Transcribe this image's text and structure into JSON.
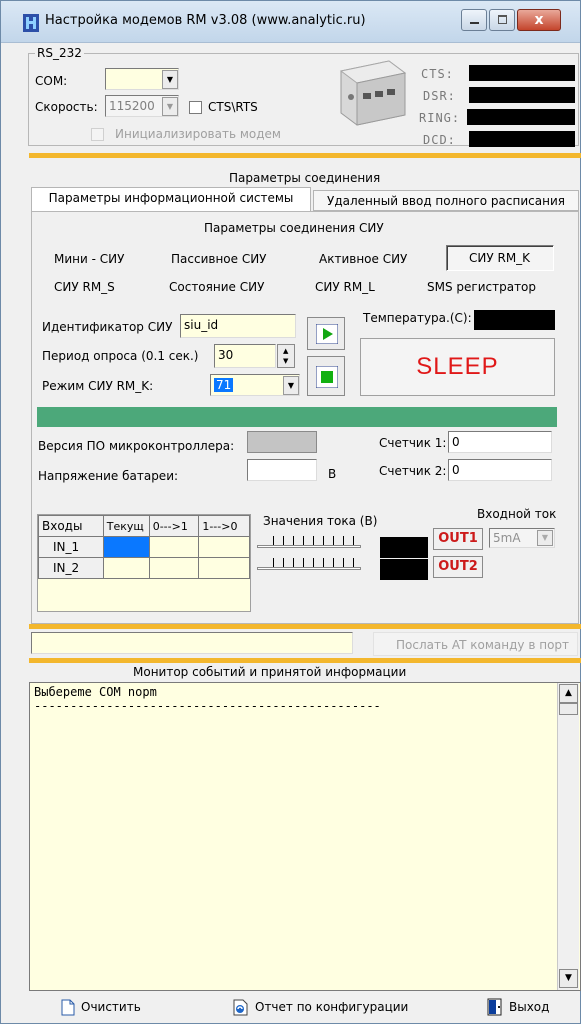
{
  "window": {
    "title": "Настройка модемов RM v3.08 (www.analytic.ru)",
    "minimize_icon": "minimize-icon",
    "maximize_icon": "maximize-icon",
    "close_icon": "close-icon",
    "close_label": "x"
  },
  "rs232": {
    "group_label": "RS_232",
    "com_label": "COM:",
    "com_value": "",
    "speed_label": "Скорость:",
    "speed_value": "115200",
    "cts_rts_label": "CTS\\RTS",
    "init_modem_label": "Инициализировать модем",
    "signals": [
      "CTS:",
      "DSR:",
      "RING:",
      "DCD:"
    ]
  },
  "connection": {
    "section_title": "Параметры соединения",
    "tabs": [
      "Параметры информационной системы",
      "Удаленный ввод полного расписания"
    ],
    "subsection_title": "Параметры соединения СИУ",
    "siu_types_row1": [
      "Мини - СИУ",
      "Пассивное СИУ",
      "Активное СИУ",
      "СИУ RM_K"
    ],
    "siu_types_row2": [
      "СИУ RM_S",
      "Состояние СИУ",
      "СИУ RM_L",
      "SMS регистратор"
    ],
    "id_label": "Идентификатор СИУ",
    "id_value": "siu_id",
    "period_label": "Период опроса (0.1 сек.)",
    "period_value": "30",
    "mode_label": "Режим СИУ RM_K:",
    "mode_value": "71",
    "temperature_label": "Температура.(С):",
    "sleep_label": "SLEEP",
    "fw_version_label": "Версия ПО микроконтроллера:",
    "battery_label": "Напряжение батареи:",
    "battery_unit": "В",
    "counter1_label": "Счетчик 1:",
    "counter1_value": "0",
    "counter2_label": "Счетчик 2:",
    "counter2_value": "0"
  },
  "inputs_table": {
    "headers": [
      "Входы",
      "Текущ",
      "0--->1",
      "1--->0"
    ],
    "rows": [
      "IN_1",
      "IN_2"
    ]
  },
  "current": {
    "values_label": "Значения тока  (В)",
    "input_current_label": "Входной ток",
    "input_current_value": "5mA",
    "out1_label": "OUT1",
    "out2_label": "OUT2"
  },
  "at_command": {
    "value": "",
    "send_label": "Послать AT команду в порт"
  },
  "monitor": {
    "title": "Монитор событий и  принятой информации",
    "text": "Выбереme COM nopm\n------------------------------------------------"
  },
  "footer": {
    "clear_label": "Очистить",
    "report_label": "Отчет по конфигурации",
    "exit_label": "Выход"
  },
  "colors": {
    "accent_gold": "#f3b72d",
    "progress_green": "#4ca87a",
    "sleep_red": "#e01818",
    "field_yellow": "#ffffe1",
    "selection_blue": "#0a78ff"
  }
}
